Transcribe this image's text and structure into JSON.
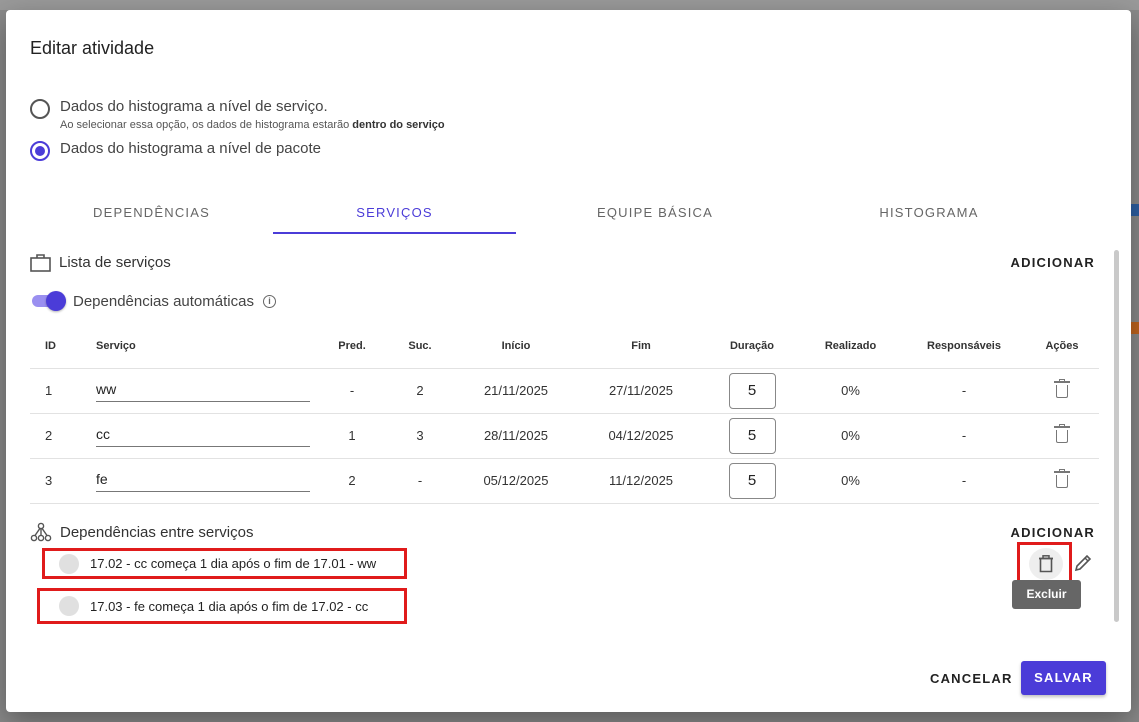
{
  "dialog": {
    "title": "Editar atividade"
  },
  "options": {
    "service_level": {
      "label": "Dados do histograma a nível de serviço.",
      "help_prefix": "Ao selecionar essa opção, os dados de histograma estarão",
      "help_bold": "dentro do serviço",
      "selected": false
    },
    "package_level": {
      "label": "Dados do histograma a nível de pacote",
      "selected": true
    }
  },
  "tabs": [
    {
      "label": "DEPENDÊNCIAS",
      "active": false
    },
    {
      "label": "SERVIÇOS",
      "active": true
    },
    {
      "label": "EQUIPE BÁSICA",
      "active": false
    },
    {
      "label": "HISTOGRAMA",
      "active": false
    }
  ],
  "services": {
    "title": "Lista de serviços",
    "add_label": "ADICIONAR",
    "toggle_label": "Dependências automáticas",
    "toggle_on": true,
    "columns": [
      "ID",
      "Serviço",
      "Pred.",
      "Suc.",
      "Início",
      "Fim",
      "Duração",
      "Realizado",
      "Responsáveis",
      "Ações"
    ],
    "rows": [
      {
        "id": "1",
        "name": "ww",
        "pred": "-",
        "suc": "2",
        "start": "21/11/2025",
        "end": "27/11/2025",
        "duration": "5",
        "done": "0%",
        "owners": "-"
      },
      {
        "id": "2",
        "name": "cc",
        "pred": "1",
        "suc": "3",
        "start": "28/11/2025",
        "end": "04/12/2025",
        "duration": "5",
        "done": "0%",
        "owners": "-"
      },
      {
        "id": "3",
        "name": "fe",
        "pred": "2",
        "suc": "-",
        "start": "05/12/2025",
        "end": "11/12/2025",
        "duration": "5",
        "done": "0%",
        "owners": "-"
      }
    ]
  },
  "dependencies": {
    "title": "Dependências entre serviços",
    "add_label": "ADICIONAR",
    "items": [
      {
        "text": "17.02 - cc começa 1 dia após o fim de 17.01 - ww"
      },
      {
        "text": "17.03 - fe começa 1 dia após o fim de 17.02 - cc"
      }
    ],
    "tooltip": "Excluir"
  },
  "footer": {
    "cancel_label": "CANCELAR",
    "save_label": "SALVAR"
  },
  "colors": {
    "accent": "#4b3cd8",
    "highlight": "#e01b1b"
  }
}
